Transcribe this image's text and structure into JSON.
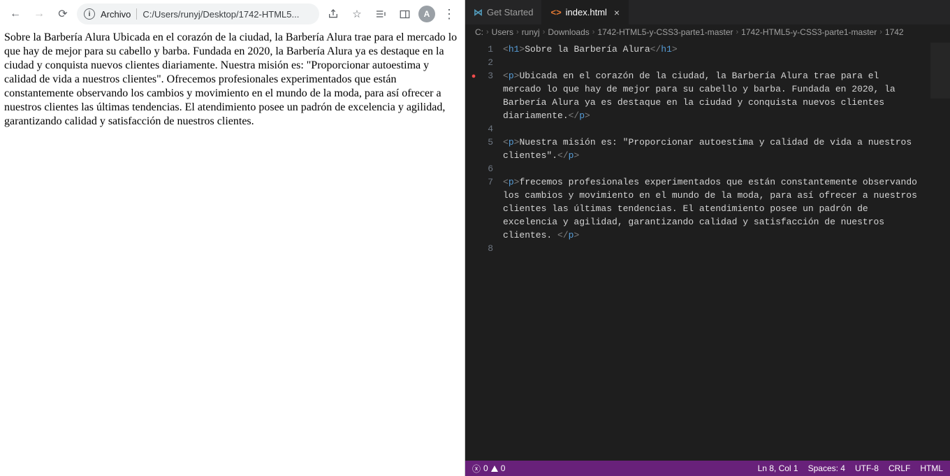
{
  "browser": {
    "omni": {
      "label": "Archivo",
      "url": "C:/Users/runyj/Desktop/1742-HTML5..."
    },
    "avatar_letter": "A",
    "page_text": "Sobre la Barbería Alura Ubicada en el corazón de la ciudad, la Barbería Alura trae para el mercado lo que hay de mejor para su cabello y barba. Fundada en 2020, la Barbería Alura ya es destaque en la ciudad y conquista nuevos clientes diariamente. Nuestra misión es: \"Proporcionar autoestima y calidad de vida a nuestros clientes\". Ofrecemos profesionales experimentados que están constantemente observando los cambios y movimiento en el mundo de la moda, para así ofrecer a nuestros clientes las últimas tendencias. El atendimiento posee un padrón de excelencia y agilidad, garantizando calidad y satisfacción de nuestros clientes."
  },
  "vscode": {
    "tabs": {
      "t0": "Get Started",
      "t1": "index.html"
    },
    "breadcrumbs": [
      "C:",
      "Users",
      "runyj",
      "Downloads",
      "1742-HTML5-y-CSS3-parte1-master",
      "1742-HTML5-y-CSS3-parte1-master",
      "1742"
    ],
    "lines": {
      "l1_text": "Sobre la Barbería Alura",
      "l3_text": "Ubicada en el corazón de la ciudad, la Barbería Alura trae para el mercado lo que hay de mejor para su cabello y barba. Fundada en 2020, la Barbería Alura ya es destaque en la ciudad y conquista nuevos clientes diariamente.",
      "l5_text": "Nuestra misión es: \"Proporcionar autoestima y calidad de vida a nuestros clientes\".",
      "l7_text": "frecemos profesionales experimentados que están constantemente observando los cambios y movimiento en el mundo de la moda, para así ofrecer a nuestros clientes las últimas tendencias. El atendimiento posee un padrón de excelencia y agilidad, garantizando calidad y satisfacción de nuestros clientes. "
    },
    "status": {
      "errors": "0",
      "warnings": "0",
      "pos": "Ln 8, Col 1",
      "spaces": "Spaces: 4",
      "encoding": "UTF-8",
      "eol": "CRLF",
      "lang": "HTML"
    }
  }
}
